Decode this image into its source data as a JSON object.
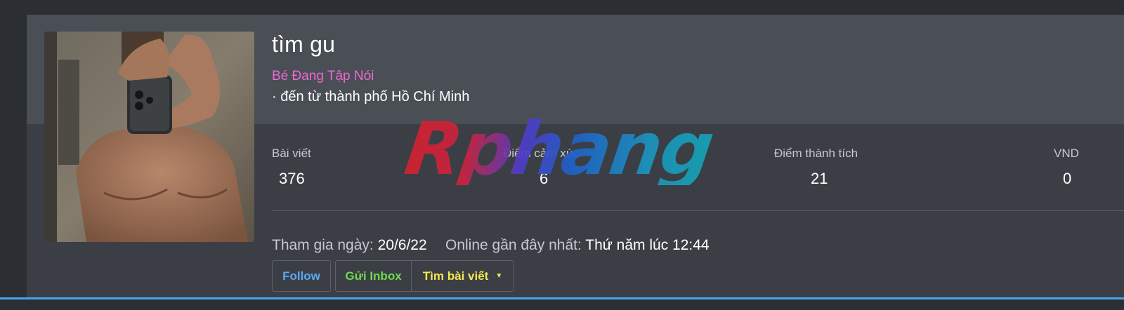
{
  "profile": {
    "username": "tìm gu",
    "user_title": "Bé Đang Tập Nói",
    "location": "· đến từ thành phố Hồ Chí Minh"
  },
  "stats": [
    {
      "label": "Bài viết",
      "value": "376"
    },
    {
      "label": "Điểm cảm xúc",
      "value": "6"
    },
    {
      "label": "Điểm thành tích",
      "value": "21"
    },
    {
      "label": "VND",
      "value": "0"
    }
  ],
  "meta": {
    "joined_label": "Tham gia ngày:",
    "joined_value": "20/6/22",
    "online_label": "Online gần đây nhất:",
    "online_value": "Thứ năm lúc 12:44"
  },
  "actions": {
    "follow": "Follow",
    "inbox": "Gửi Inbox",
    "find_posts": "Tìm bài viết"
  },
  "watermark": {
    "text": "Rphang"
  },
  "colors": {
    "background": "#2b2e33",
    "card": "#3b3f45",
    "card_header": "#4a4e55",
    "user_title": "#ec6ad0",
    "follow": "#5aa9f5",
    "inbox": "#6cdc4a",
    "find_posts": "#f1e84b",
    "accent_line": "#4aa3ec"
  }
}
